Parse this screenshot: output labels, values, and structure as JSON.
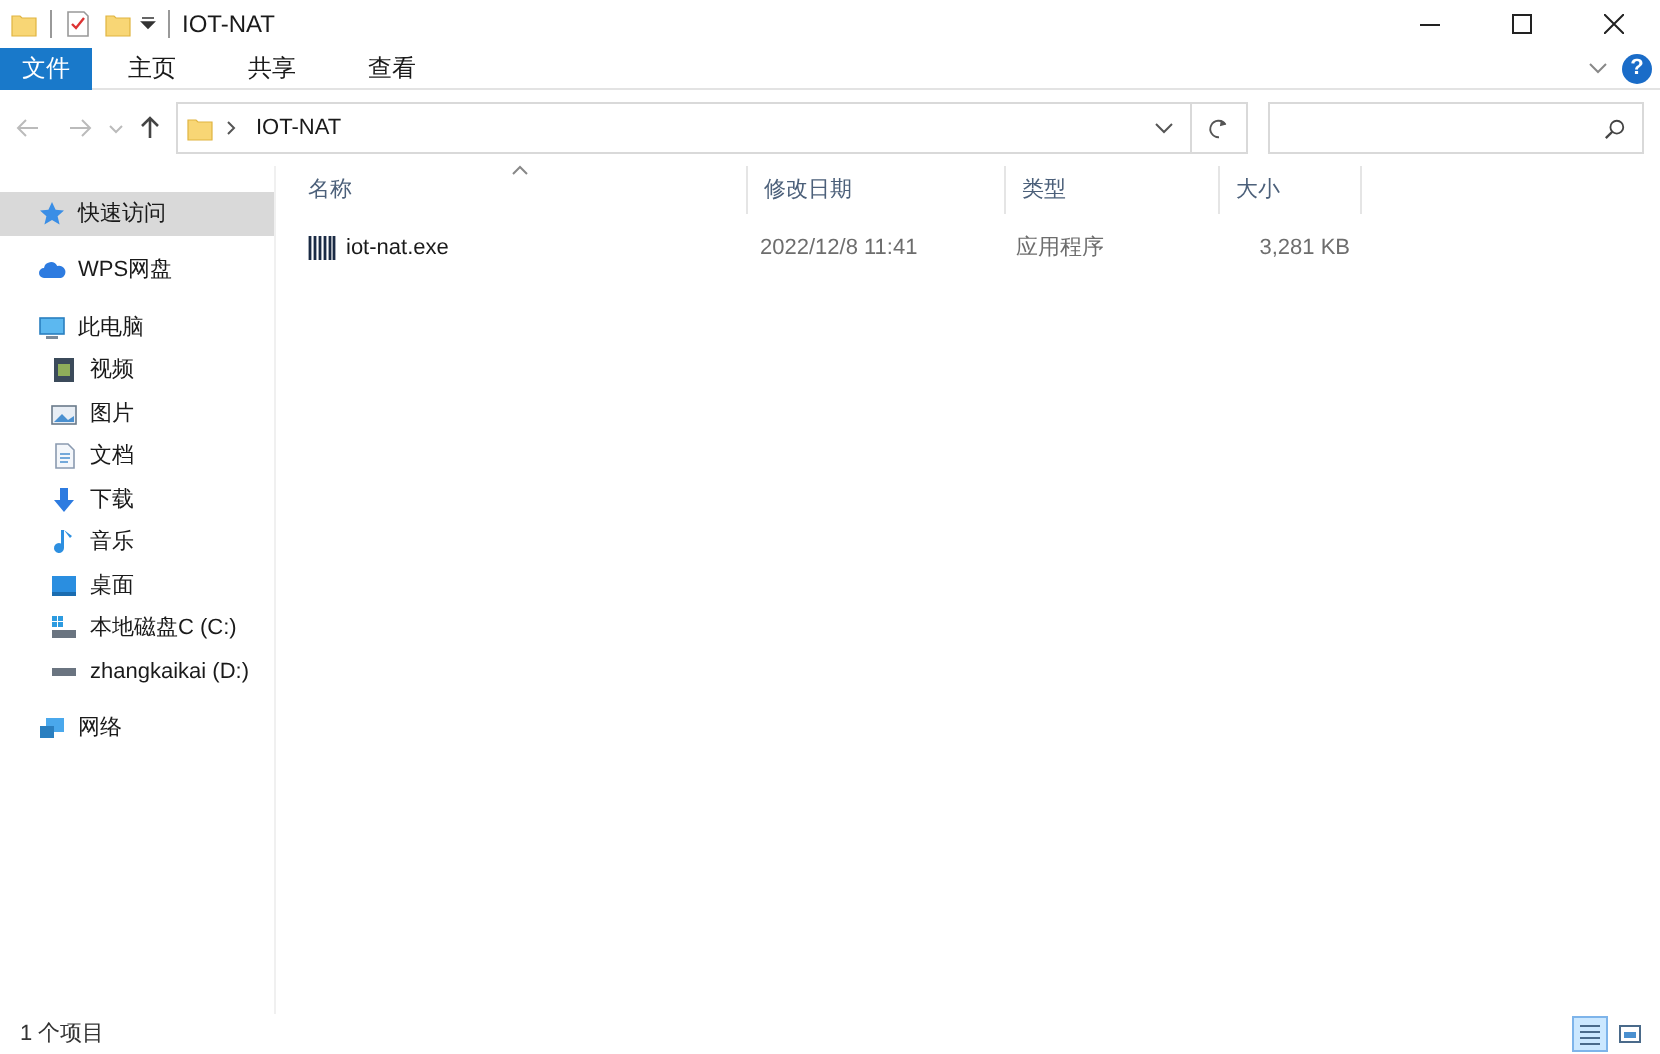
{
  "window": {
    "title": "IOT-NAT"
  },
  "ribbon_tabs": [
    {
      "label": "文件",
      "kind": "file-menu"
    },
    {
      "label": "主页",
      "kind": "tab"
    },
    {
      "label": "共享",
      "kind": "tab"
    },
    {
      "label": "查看",
      "kind": "tab"
    }
  ],
  "help_button": {
    "label": "?"
  },
  "address_bar": {
    "path": "IOT-NAT"
  },
  "sidebar": {
    "items": [
      {
        "label": "快速访问",
        "kind": "star",
        "selected": true
      },
      {
        "label": "WPS网盘",
        "kind": "cloud",
        "selected": false
      },
      {
        "label": "此电脑",
        "kind": "pc",
        "selected": false,
        "children": [
          {
            "label": "视频",
            "kind": "video",
            "selected": false
          },
          {
            "label": "图片",
            "kind": "picture",
            "selected": false
          },
          {
            "label": "文档",
            "kind": "document",
            "selected": false
          },
          {
            "label": "下载",
            "kind": "download",
            "selected": false
          },
          {
            "label": "音乐",
            "kind": "music",
            "selected": false
          },
          {
            "label": "桌面",
            "kind": "desktop",
            "selected": false
          },
          {
            "label": "本地磁盘C (C:)",
            "kind": "system-drive",
            "selected": false
          },
          {
            "label": "zhangkaikai (D:)",
            "kind": "drive",
            "selected": false
          }
        ]
      },
      {
        "label": "网络",
        "kind": "network",
        "selected": false
      }
    ]
  },
  "table": {
    "columns": [
      {
        "label": "名称",
        "sorted": true
      },
      {
        "label": "修改日期",
        "sorted": false
      },
      {
        "label": "类型",
        "sorted": false
      },
      {
        "label": "大小",
        "sorted": false
      }
    ],
    "rows": [
      {
        "name": "iot-nat.exe",
        "modified": "2022/12/8 11:41",
        "type": "应用程序",
        "size": "3,281 KB"
      }
    ]
  },
  "status_bar": {
    "text": "1 个项目",
    "views": [
      {
        "kind": "details",
        "selected": true
      },
      {
        "kind": "large-icons",
        "selected": false
      }
    ]
  }
}
